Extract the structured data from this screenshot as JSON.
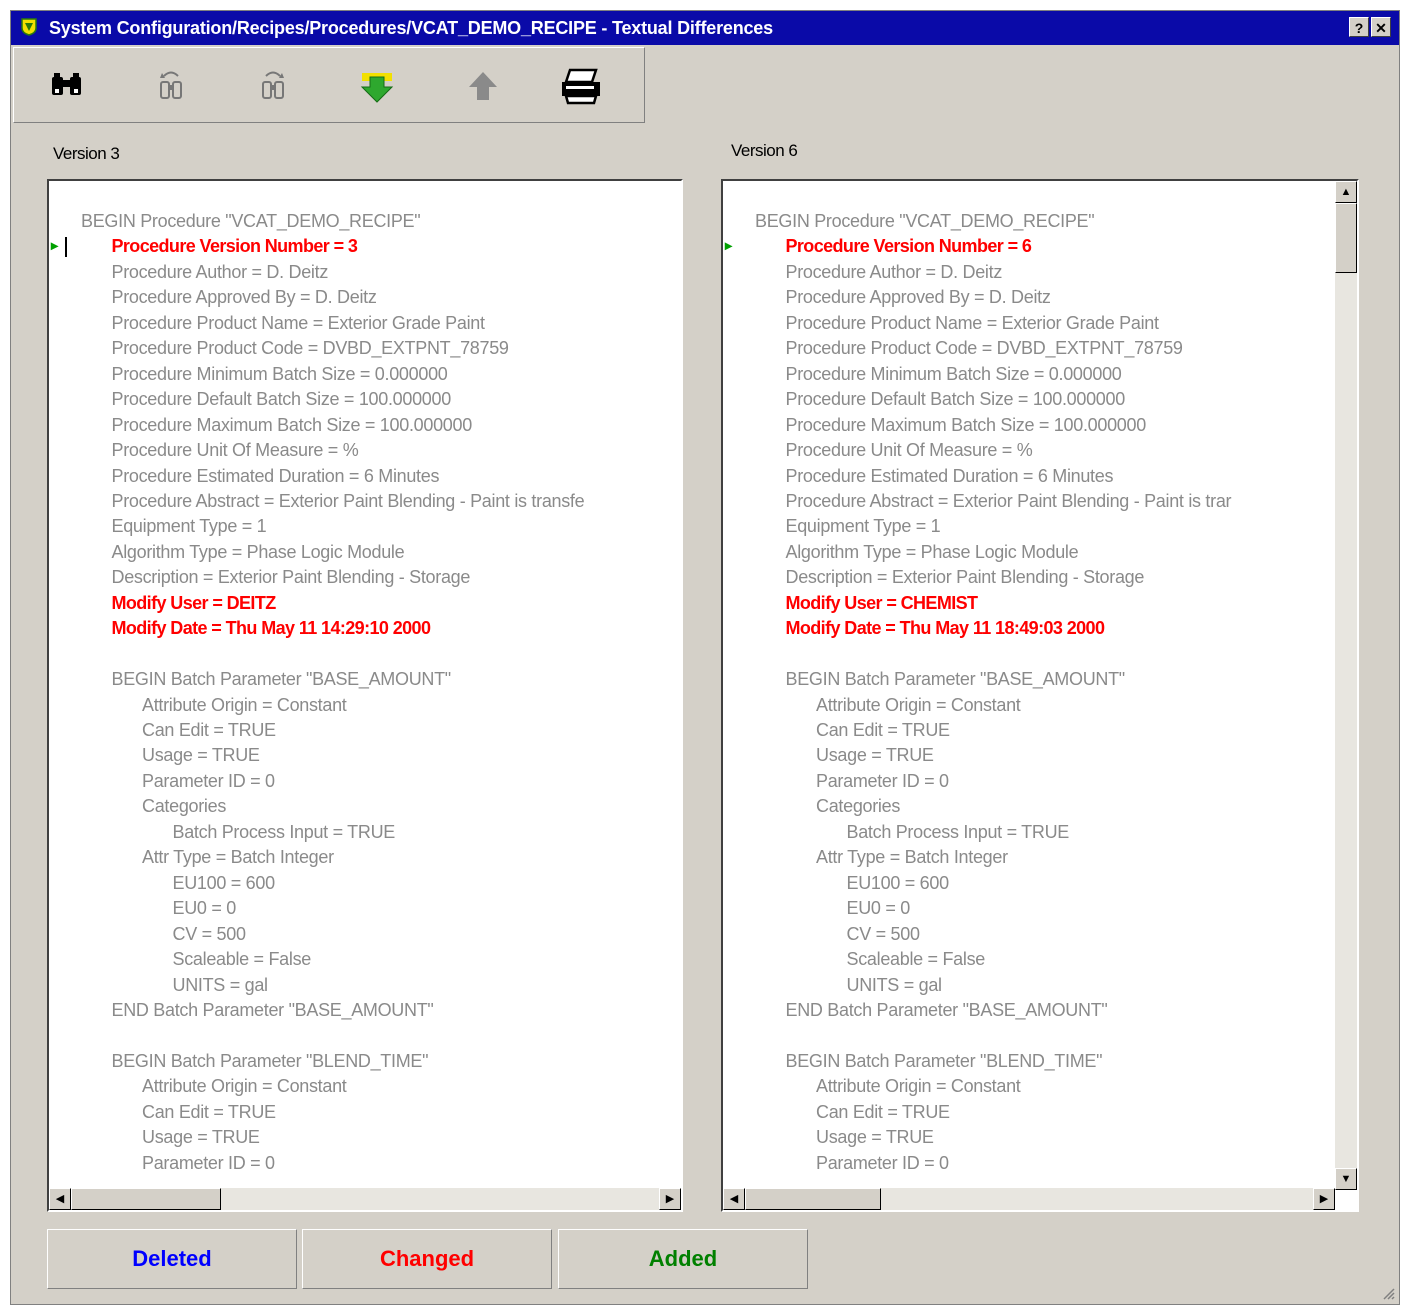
{
  "window": {
    "title": "System Configuration/Recipes/Procedures/VCAT_DEMO_RECIPE - Textual Differences",
    "help_label": "?",
    "close_label": "✕"
  },
  "toolbar": {
    "icons": [
      "find-icon",
      "find-previous-icon",
      "find-next-icon",
      "next-difference-icon",
      "previous-difference-icon",
      "print-icon"
    ]
  },
  "left": {
    "label": "Version 3",
    "lines": [
      {
        "text": "BEGIN Procedure \"VCAT_DEMO_RECIPE\"",
        "indent": 0,
        "changed": false
      },
      {
        "text": "Procedure Version Number  =  3",
        "indent": 1,
        "changed": true
      },
      {
        "text": "Procedure Author  =  D. Deitz",
        "indent": 1,
        "changed": false
      },
      {
        "text": "Procedure Approved By  =  D. Deitz",
        "indent": 1,
        "changed": false
      },
      {
        "text": "Procedure Product Name  =  Exterior Grade Paint",
        "indent": 1,
        "changed": false
      },
      {
        "text": "Procedure Product Code  =  DVBD_EXTPNT_78759",
        "indent": 1,
        "changed": false
      },
      {
        "text": "Procedure Minimum Batch Size  =  0.000000",
        "indent": 1,
        "changed": false
      },
      {
        "text": "Procedure Default Batch Size  =  100.000000",
        "indent": 1,
        "changed": false
      },
      {
        "text": "Procedure Maximum Batch Size  =  100.000000",
        "indent": 1,
        "changed": false
      },
      {
        "text": "Procedure Unit Of Measure  =  %",
        "indent": 1,
        "changed": false
      },
      {
        "text": "Procedure Estimated Duration  =  6 Minutes",
        "indent": 1,
        "changed": false
      },
      {
        "text": "Procedure Abstract  =  Exterior Paint Blending - Paint is transfe",
        "indent": 1,
        "changed": false
      },
      {
        "text": "Equipment Type  =  1",
        "indent": 1,
        "changed": false
      },
      {
        "text": "Algorithm Type  =  Phase Logic Module",
        "indent": 1,
        "changed": false
      },
      {
        "text": "Description  =  Exterior Paint Blending - Storage",
        "indent": 1,
        "changed": false
      },
      {
        "text": "Modify User  =  DEITZ",
        "indent": 1,
        "changed": true
      },
      {
        "text": "Modify Date  =  Thu May 11 14:29:10 2000",
        "indent": 1,
        "changed": true
      },
      {
        "text": "",
        "indent": 1,
        "changed": false
      },
      {
        "text": "BEGIN Batch Parameter \"BASE_AMOUNT\"",
        "indent": 1,
        "changed": false
      },
      {
        "text": "Attribute Origin  =  Constant",
        "indent": 2,
        "changed": false
      },
      {
        "text": "Can Edit  =  TRUE",
        "indent": 2,
        "changed": false
      },
      {
        "text": "Usage  =  TRUE",
        "indent": 2,
        "changed": false
      },
      {
        "text": "Parameter ID  =  0",
        "indent": 2,
        "changed": false
      },
      {
        "text": "Categories",
        "indent": 2,
        "changed": false
      },
      {
        "text": "Batch Process Input  =  TRUE",
        "indent": 3,
        "changed": false
      },
      {
        "text": "Attr Type = Batch Integer",
        "indent": 2,
        "changed": false
      },
      {
        "text": "EU100  =  600",
        "indent": 3,
        "changed": false
      },
      {
        "text": "EU0  =  0",
        "indent": 3,
        "changed": false
      },
      {
        "text": "CV  =  500",
        "indent": 3,
        "changed": false
      },
      {
        "text": "Scaleable  =  False",
        "indent": 3,
        "changed": false
      },
      {
        "text": "UNITS  =  gal",
        "indent": 3,
        "changed": false
      },
      {
        "text": "END Batch Parameter \"BASE_AMOUNT\"",
        "indent": 1,
        "changed": false
      },
      {
        "text": "",
        "indent": 1,
        "changed": false
      },
      {
        "text": "BEGIN Batch Parameter \"BLEND_TIME\"",
        "indent": 1,
        "changed": false
      },
      {
        "text": "Attribute Origin  =  Constant",
        "indent": 2,
        "changed": false
      },
      {
        "text": "Can Edit  =  TRUE",
        "indent": 2,
        "changed": false
      },
      {
        "text": "Usage  =  TRUE",
        "indent": 2,
        "changed": false
      },
      {
        "text": "Parameter ID  =  0",
        "indent": 2,
        "changed": false
      }
    ]
  },
  "right": {
    "label": "Version 6",
    "lines": [
      {
        "text": "BEGIN Procedure \"VCAT_DEMO_RECIPE\"",
        "indent": 0,
        "changed": false
      },
      {
        "text": "Procedure Version Number  =  6",
        "indent": 1,
        "changed": true
      },
      {
        "text": "Procedure Author  =  D. Deitz",
        "indent": 1,
        "changed": false
      },
      {
        "text": "Procedure Approved By  =  D. Deitz",
        "indent": 1,
        "changed": false
      },
      {
        "text": "Procedure Product Name  =  Exterior Grade Paint",
        "indent": 1,
        "changed": false
      },
      {
        "text": "Procedure Product Code  =  DVBD_EXTPNT_78759",
        "indent": 1,
        "changed": false
      },
      {
        "text": "Procedure Minimum Batch Size  =  0.000000",
        "indent": 1,
        "changed": false
      },
      {
        "text": "Procedure Default Batch Size  =  100.000000",
        "indent": 1,
        "changed": false
      },
      {
        "text": "Procedure Maximum Batch Size  =  100.000000",
        "indent": 1,
        "changed": false
      },
      {
        "text": "Procedure Unit Of Measure  =  %",
        "indent": 1,
        "changed": false
      },
      {
        "text": "Procedure Estimated Duration  =  6 Minutes",
        "indent": 1,
        "changed": false
      },
      {
        "text": "Procedure Abstract  =  Exterior Paint Blending - Paint is trar",
        "indent": 1,
        "changed": false
      },
      {
        "text": "Equipment Type  =  1",
        "indent": 1,
        "changed": false
      },
      {
        "text": "Algorithm Type  =  Phase Logic Module",
        "indent": 1,
        "changed": false
      },
      {
        "text": "Description  =  Exterior Paint Blending - Storage",
        "indent": 1,
        "changed": false
      },
      {
        "text": "Modify User  =  CHEMIST",
        "indent": 1,
        "changed": true
      },
      {
        "text": "Modify Date  =  Thu May 11 18:49:03 2000",
        "indent": 1,
        "changed": true
      },
      {
        "text": "",
        "indent": 1,
        "changed": false
      },
      {
        "text": "BEGIN Batch Parameter \"BASE_AMOUNT\"",
        "indent": 1,
        "changed": false
      },
      {
        "text": "Attribute Origin  =  Constant",
        "indent": 2,
        "changed": false
      },
      {
        "text": "Can Edit  =  TRUE",
        "indent": 2,
        "changed": false
      },
      {
        "text": "Usage  =  TRUE",
        "indent": 2,
        "changed": false
      },
      {
        "text": "Parameter ID  =  0",
        "indent": 2,
        "changed": false
      },
      {
        "text": "Categories",
        "indent": 2,
        "changed": false
      },
      {
        "text": "Batch Process Input  =  TRUE",
        "indent": 3,
        "changed": false
      },
      {
        "text": "Attr Type = Batch Integer",
        "indent": 2,
        "changed": false
      },
      {
        "text": "EU100  =  600",
        "indent": 3,
        "changed": false
      },
      {
        "text": "EU0  =  0",
        "indent": 3,
        "changed": false
      },
      {
        "text": "CV  =  500",
        "indent": 3,
        "changed": false
      },
      {
        "text": "Scaleable  =  False",
        "indent": 3,
        "changed": false
      },
      {
        "text": "UNITS  =  gal",
        "indent": 3,
        "changed": false
      },
      {
        "text": "END Batch Parameter \"BASE_AMOUNT\"",
        "indent": 1,
        "changed": false
      },
      {
        "text": "",
        "indent": 1,
        "changed": false
      },
      {
        "text": "BEGIN Batch Parameter \"BLEND_TIME\"",
        "indent": 1,
        "changed": false
      },
      {
        "text": "Attribute Origin  =  Constant",
        "indent": 2,
        "changed": false
      },
      {
        "text": "Can Edit  =  TRUE",
        "indent": 2,
        "changed": false
      },
      {
        "text": "Usage  =  TRUE",
        "indent": 2,
        "changed": false
      },
      {
        "text": "Parameter ID  =  0",
        "indent": 2,
        "changed": false
      }
    ]
  },
  "legend": {
    "deleted": "Deleted",
    "changed": "Changed",
    "added": "Added"
  },
  "colors": {
    "title_bar": "#0a0aa8",
    "changed": "#ff0000",
    "deleted": "#0000ff",
    "added": "#008000",
    "unchanged_text": "#8a8a8a",
    "marker": "#00a000"
  }
}
